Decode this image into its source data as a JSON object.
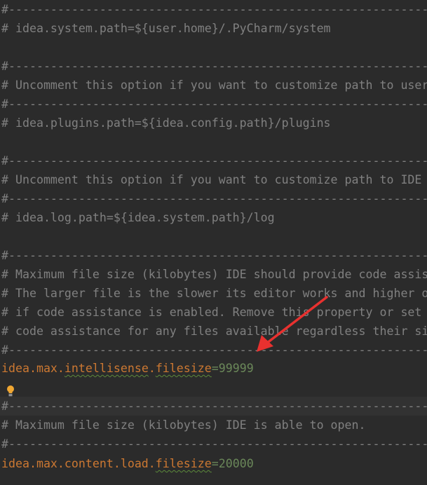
{
  "lines": {
    "l0": "#-----------------------------------------------------------------------",
    "l1": "# idea.system.path=${user.home}/.PyCharm/system",
    "l3": "#-----------------------------------------------------------------------",
    "l4": "# Uncomment this option if you want to customize path to user installed plugins",
    "l5": "#-----------------------------------------------------------------------",
    "l6": "# idea.plugins.path=${idea.config.path}/plugins",
    "l8": "#-----------------------------------------------------------------------",
    "l9": "# Uncomment this option if you want to customize path to IDE logs folder",
    "l10": "#-----------------------------------------------------------------------",
    "l11": "# idea.log.path=${idea.system.path}/log",
    "l13": "#-----------------------------------------------------------------------",
    "l14": "# Maximum file size (kilobytes) IDE should provide code assistance for.",
    "l15": "# The larger file is the slower its editor works and higher overall system",
    "l16": "# if code assistance is enabled. Remove this property or set it to very large",
    "l17": "# code assistance for any files available regardless their size.",
    "l18": "#-----------------------------------------------------------------------",
    "l21": "#-----------------------------------------------------------------------",
    "l22": "# Maximum file size (kilobytes) IDE is able to open.",
    "l23": "#-----------------------------------------------------------------------"
  },
  "props": {
    "intellisense": {
      "k1": "idea.max.",
      "k2": "intellisense",
      "k3": ".",
      "k4": "filesize",
      "eq": "=",
      "value": "99999"
    },
    "content": {
      "k1": "idea.max.content.load.",
      "k2": "filesize",
      "eq": "=",
      "value": "20000"
    }
  },
  "colors": {
    "background": "#2b2b2b",
    "comment": "#808080",
    "key": "#cc7832",
    "value": "#6a8759",
    "arrow": "#e8312f",
    "bulb": "#f0a732"
  }
}
